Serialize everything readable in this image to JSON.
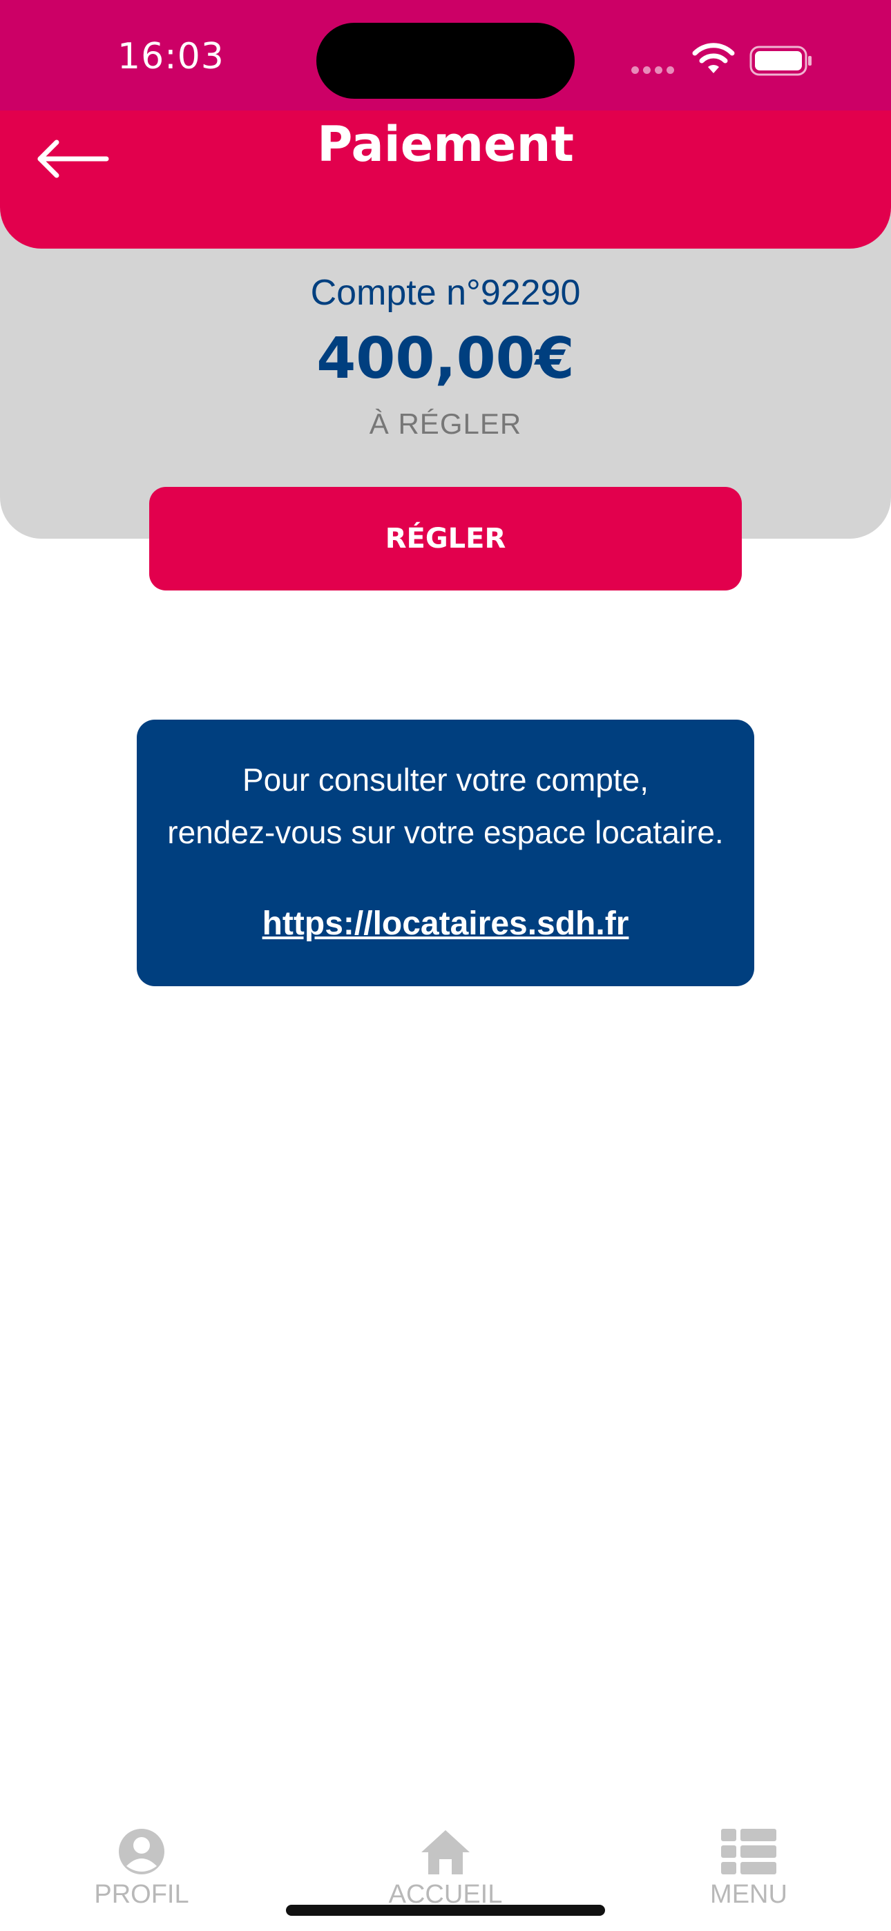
{
  "status_bar": {
    "time": "16:03",
    "background": "#cc0066"
  },
  "header": {
    "title": "Paiement",
    "back_icon": "arrow-left-icon",
    "background": "#e2004d"
  },
  "account": {
    "number_label": "Compte n°92290",
    "amount": "400,00€",
    "status": "À RÉGLER"
  },
  "pay_button": {
    "label": "RÉGLER"
  },
  "info_card": {
    "line1": "Pour consulter votre compte,",
    "line2": "rendez-vous sur votre espace locataire.",
    "link": "https://locataires.sdh.fr",
    "background": "#003f7f"
  },
  "tab_bar": {
    "items": [
      {
        "label": "PROFIL",
        "icon": "user-circle-icon"
      },
      {
        "label": "ACCUEIL",
        "icon": "home-icon"
      },
      {
        "label": "MENU",
        "icon": "list-icon"
      }
    ]
  }
}
